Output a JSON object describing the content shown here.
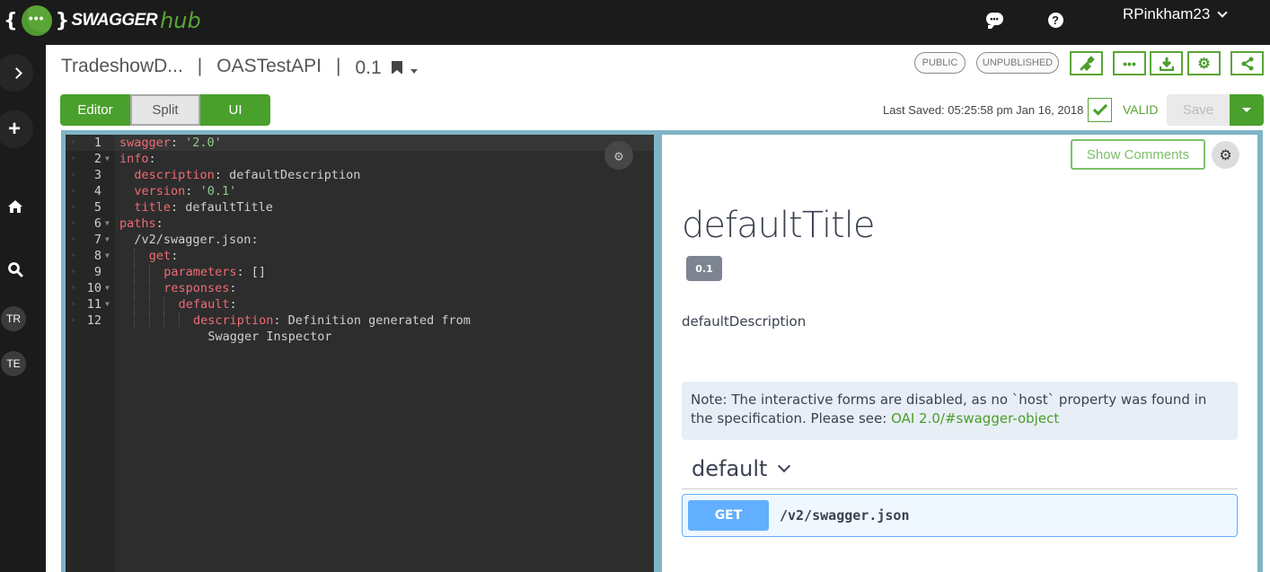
{
  "topbar": {
    "logo": {
      "brace_open": "{",
      "dots": "•••",
      "brace_close": "}",
      "word": "SWAGGER",
      "hub": "hub"
    },
    "chat_glyph": "•••",
    "help_glyph": "?",
    "username": "RPinkham23"
  },
  "sidebar": {
    "add_glyph": "+",
    "avatars": [
      "TR",
      "TE"
    ]
  },
  "header": {
    "breadcrumb": {
      "org": "TradeshowD...",
      "api": "OASTestAPI",
      "version": "0.1",
      "separator": "|"
    },
    "badges": {
      "public": "PUBLIC",
      "unpublished": "UNPUBLISHED"
    },
    "toolbar": {
      "more_glyph": "•••",
      "settings_glyph": "⚙"
    }
  },
  "view_toggle": {
    "editor": "Editor",
    "split": "Split",
    "ui": "UI",
    "active": "Split"
  },
  "status": {
    "last_saved": "Last Saved: 05:25:58 pm Jan 16, 2018",
    "validity": "VALID",
    "save_label": "Save"
  },
  "editor": {
    "gear_glyph": "⚙",
    "lines": [
      {
        "n": "1",
        "fold": false,
        "indent": 0,
        "key": "swagger",
        "value": "'2.0'",
        "value_type": "string"
      },
      {
        "n": "2",
        "fold": true,
        "indent": 0,
        "key": "info",
        "value": "",
        "value_type": ""
      },
      {
        "n": "3",
        "fold": false,
        "indent": 1,
        "key": "description",
        "value": "defaultDescription",
        "value_type": "plain"
      },
      {
        "n": "4",
        "fold": false,
        "indent": 1,
        "key": "version",
        "value": "'0.1'",
        "value_type": "string"
      },
      {
        "n": "5",
        "fold": false,
        "indent": 1,
        "key": "title",
        "value": "defaultTitle",
        "value_type": "plain"
      },
      {
        "n": "6",
        "fold": true,
        "indent": 0,
        "key": "paths",
        "value": "",
        "value_type": ""
      },
      {
        "n": "7",
        "fold": true,
        "indent": 1,
        "key": "/v2/swagger.json",
        "value": "",
        "value_type": "path"
      },
      {
        "n": "8",
        "fold": true,
        "indent": 2,
        "key": "get",
        "value": "",
        "value_type": ""
      },
      {
        "n": "9",
        "fold": false,
        "indent": 3,
        "key": "parameters",
        "value": "[]",
        "value_type": "plain"
      },
      {
        "n": "10",
        "fold": true,
        "indent": 3,
        "key": "responses",
        "value": "",
        "value_type": ""
      },
      {
        "n": "11",
        "fold": true,
        "indent": 4,
        "key": "default",
        "value": "",
        "value_type": ""
      },
      {
        "n": "12",
        "fold": false,
        "indent": 5,
        "key": "description",
        "value": "Definition generated from",
        "value_type": "plain",
        "wrap": "Swagger Inspector"
      }
    ]
  },
  "preview": {
    "show_comments": "Show Comments",
    "gear_glyph": "⚙",
    "title": "defaultTitle",
    "version": "0.1",
    "description": "defaultDescription",
    "note_text": "Note: The interactive forms are disabled, as no `host` property was found in the specification. Please see: ",
    "note_link": "OAI 2.0/#swagger-object",
    "tag": "default",
    "operation": {
      "method": "GET",
      "path": "/v2/swagger.json"
    }
  },
  "colors": {
    "brand_green": "#4aa02c",
    "topbar_bg": "#1b1b1b",
    "frame_blue": "#7fb4c6",
    "editor_bg": "#2d2d2d",
    "yaml_key": "#ef6b73",
    "yaml_string": "#8fc98f",
    "get_blue": "#61affe"
  }
}
